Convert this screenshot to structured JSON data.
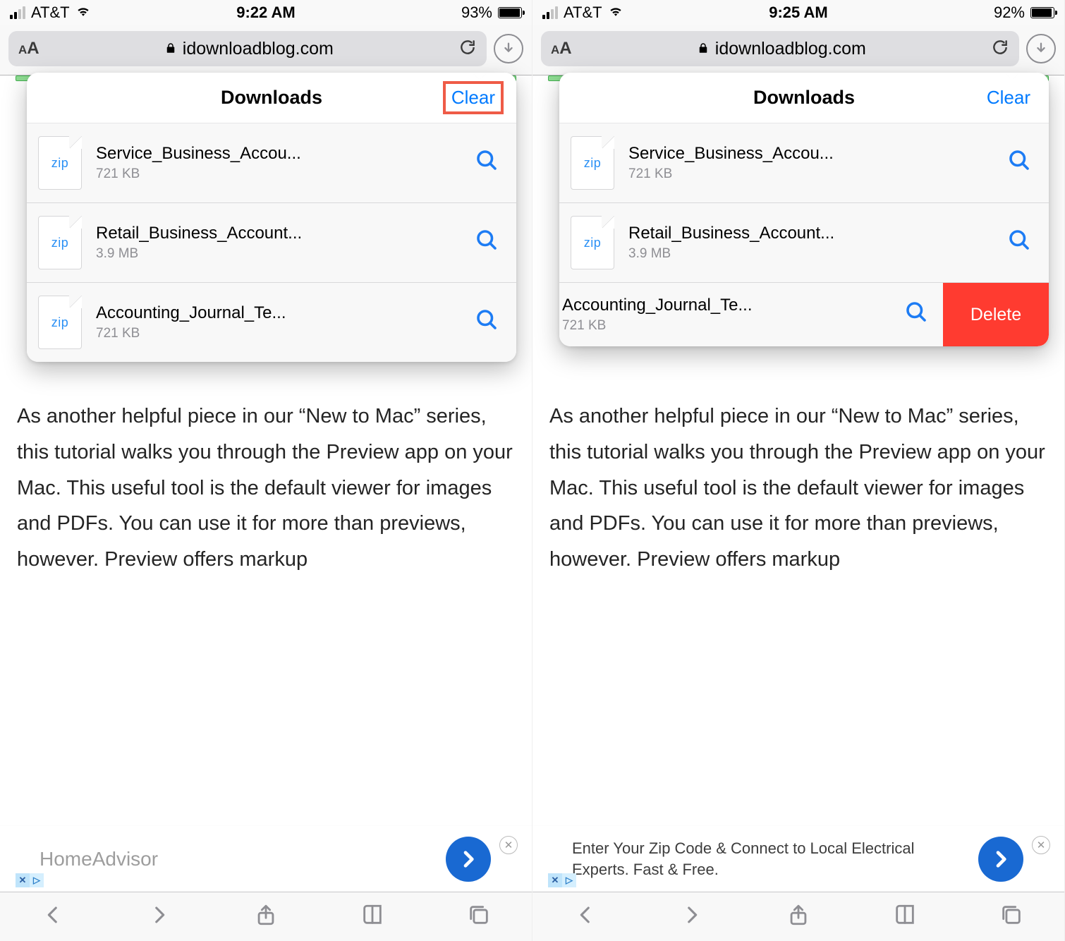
{
  "panes": [
    {
      "status": {
        "carrier": "AT&T",
        "time": "9:22 AM",
        "battery_pct": "93%"
      },
      "url_domain": "idownloadblog.com",
      "popover_title": "Downloads",
      "popover_clear": "Clear",
      "clear_highlighted": true,
      "items": [
        {
          "ext": "zip",
          "name": "Service_Business_Accou...",
          "size": "721 KB"
        },
        {
          "ext": "zip",
          "name": "Retail_Business_Account...",
          "size": "3.9 MB"
        },
        {
          "ext": "zip",
          "name": "Accounting_Journal_Te...",
          "size": "721 KB"
        }
      ],
      "article_text": "As another helpful piece in our “New to Mac” series, this tutorial walks you through the Preview app on your Mac. This useful tool is the default viewer for images and PDFs. You can use it for more than previews, however. Preview offers markup",
      "ad_text": "HomeAdvisor",
      "ad_muted": true
    },
    {
      "status": {
        "carrier": "AT&T",
        "time": "9:25 AM",
        "battery_pct": "92%"
      },
      "url_domain": "idownloadblog.com",
      "popover_title": "Downloads",
      "popover_clear": "Clear",
      "clear_highlighted": false,
      "swiped_index": 2,
      "delete_label": "Delete",
      "items": [
        {
          "ext": "zip",
          "name": "Service_Business_Accou...",
          "size": "721 KB"
        },
        {
          "ext": "zip",
          "name": "Retail_Business_Account...",
          "size": "3.9 MB"
        },
        {
          "ext": "zip",
          "name": "Accounting_Journal_Te...",
          "size": "721 KB"
        }
      ],
      "article_text": "As another helpful piece in our “New to Mac” series, this tutorial walks you through the Preview app on your Mac. This useful tool is the default viewer for images and PDFs. You can use it for more than previews, however. Preview offers markup",
      "ad_text": "Enter Your Zip Code & Connect to Local Electrical Experts. Fast & Free.",
      "ad_muted": false
    }
  ]
}
